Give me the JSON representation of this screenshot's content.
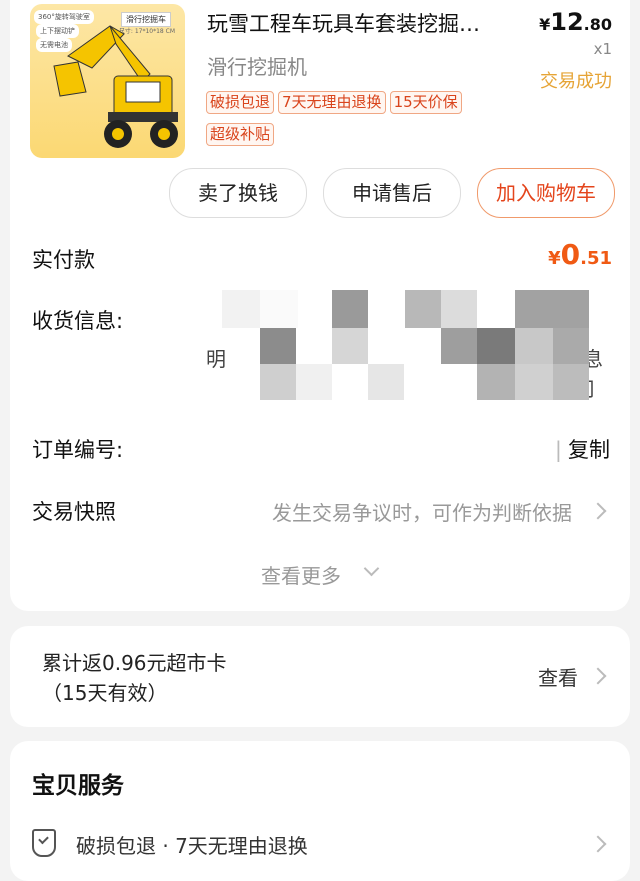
{
  "product": {
    "title": "玩雪工程车玩具车套装挖掘…",
    "variant": "滑行挖掘机",
    "price_currency": "¥",
    "price_int": "12",
    "price_dec": ".80",
    "quantity": "x1",
    "status": "交易成功",
    "badges": [
      "破损包退",
      "7天无理由退换",
      "15天价保",
      "超级补贴"
    ],
    "image_tags": [
      "360°旋转驾驶室",
      "上下摆动铲",
      "无需电池"
    ],
    "image_name_tag": "滑行挖掘车",
    "image_size": "尺寸: 17*10*18 CM"
  },
  "actions": {
    "sell": "卖了换钱",
    "after_sale": "申请售后",
    "add_cart": "加入购物车"
  },
  "payment": {
    "label": "实付款",
    "currency": "¥",
    "int": "0",
    "dec": ".51"
  },
  "shipping": {
    "label": "收货信息:",
    "line1_start": "明",
    "line1_end": "息",
    "line2_end": "司"
  },
  "order": {
    "label": "订单编号:",
    "copy": "复制"
  },
  "snapshot": {
    "label": "交易快照",
    "desc": "发生交易争议时，可作为判断依据"
  },
  "more": "查看更多",
  "rebate": {
    "line1": "累计返0.96元超市卡",
    "line2": "（15天有效）",
    "view": "查看"
  },
  "service": {
    "title": "宝贝服务",
    "item": "破损包退 · 7天无理由退换"
  },
  "colors": {
    "accent": "#f05a14",
    "status": "#e6a436"
  }
}
